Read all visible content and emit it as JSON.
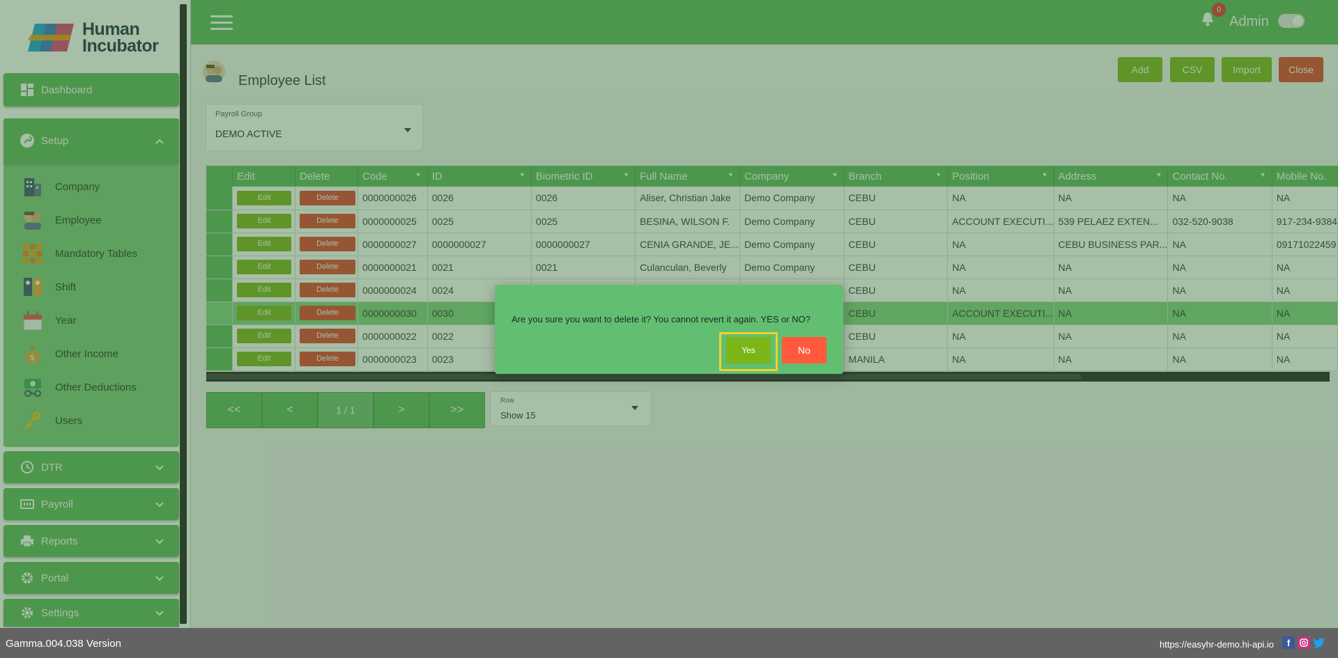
{
  "brand": {
    "name_line1": "Human",
    "name_line2": "Incubator"
  },
  "sidebar": {
    "dashboard": "Dashboard",
    "setup": "Setup",
    "setup_items": [
      "Company",
      "Employee",
      "Mandatory Tables",
      "Shift",
      "Year",
      "Other Income",
      "Other Deductions",
      "Users"
    ],
    "sections": [
      "DTR",
      "Payroll",
      "Reports",
      "Portal",
      "Settings"
    ]
  },
  "header": {
    "notification_count": "0",
    "user": "Admin"
  },
  "page": {
    "title": "Employee List",
    "buttons": {
      "add": "Add",
      "csv": "CSV",
      "import": "Import",
      "close": "Close"
    }
  },
  "payroll_group": {
    "label": "Payroll Group",
    "value": "DEMO ACTIVE"
  },
  "table": {
    "columns": [
      "Edit",
      "Delete",
      "Code",
      "ID",
      "Biometric ID",
      "Full Name",
      "Company",
      "Branch",
      "Position",
      "Address",
      "Contact No.",
      "Mobile No."
    ],
    "edit_label": "Edit",
    "delete_label": "Delete",
    "rows": [
      [
        "0000000026",
        "0026",
        "0026",
        "Aliser, Christian Jake",
        "Demo Company",
        "CEBU",
        "NA",
        "NA",
        "NA",
        "NA"
      ],
      [
        "0000000025",
        "0025",
        "0025",
        "BESINA, WILSON F.",
        "Demo Company",
        "CEBU",
        "ACCOUNT EXECUTI...",
        "539 PELAEZ EXTEN...",
        "032-520-9038",
        "917-234-9384"
      ],
      [
        "0000000027",
        "0000000027",
        "0000000027",
        "CENIA GRANDE, JE...",
        "Demo Company",
        "CEBU",
        "NA",
        "CEBU BUSINESS PAR...",
        "NA",
        "09171022459"
      ],
      [
        "0000000021",
        "0021",
        "0021",
        "Culanculan, Beverly",
        "Demo Company",
        "CEBU",
        "NA",
        "NA",
        "NA",
        "NA"
      ],
      [
        "0000000024",
        "0024",
        "",
        "",
        "",
        "CEBU",
        "NA",
        "NA",
        "NA",
        "NA"
      ],
      [
        "0000000030",
        "0030",
        "",
        "",
        "",
        "CEBU",
        "ACCOUNT EXECUTI...",
        "NA",
        "NA",
        "NA"
      ],
      [
        "0000000022",
        "0022",
        "",
        "",
        "",
        "CEBU",
        "NA",
        "NA",
        "NA",
        "NA"
      ],
      [
        "0000000023",
        "0023",
        "",
        "",
        "",
        "MANILA",
        "NA",
        "NA",
        "NA",
        "NA"
      ]
    ],
    "highlighted_row": 5
  },
  "pager": {
    "first": "<<",
    "prev": "<",
    "info": "1 / 1",
    "next": ">",
    "last": ">>"
  },
  "row_select": {
    "label": "Row",
    "value": "Show 15"
  },
  "footer": {
    "version": "Gamma.004.038 Version",
    "url": "https://easyhr-demo.hi-api.io"
  },
  "dialog": {
    "message": "Are you sure you want to delete it? You cannot revert it again. YES or NO?",
    "yes": "Yes",
    "no": "No"
  },
  "colors": {
    "primary": "#5cb85c",
    "edit": "#7cb518",
    "danger": "#e0402c",
    "highlight": "#f4d12a"
  }
}
